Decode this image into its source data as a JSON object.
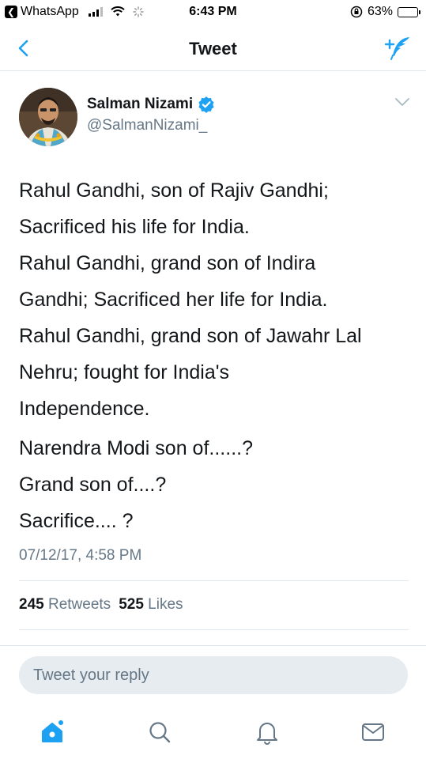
{
  "status_bar": {
    "back_app": "WhatsApp",
    "time": "6:43 PM",
    "battery": "63%",
    "battery_level": 0.63
  },
  "nav": {
    "title": "Tweet",
    "back_icon": "chevron-left-icon",
    "compose_icon": "compose-tweet-icon"
  },
  "tweet": {
    "author_name": "Salman Nizami",
    "author_handle": "@SalmanNizami_",
    "lines": [
      "Rahul Gandhi, son of Rajiv Gandhi;",
      "Sacrificed his life for India.",
      "Rahul Gandhi, grand son of Indira",
      "Gandhi; Sacrificed her life for India.",
      "Rahul Gandhi, grand son of Jawahr Lal",
      "Nehru; fought for India's",
      "Independence."
    ],
    "questions": [
      "Narendra Modi son of......?",
      "Grand son of....?",
      "Sacrifice.... ?"
    ],
    "timestamp": "07/12/17, 4:58 PM",
    "retweets_count": "245",
    "retweets_label": "Retweets",
    "likes_count": "525",
    "likes_label": "Likes"
  },
  "reply": {
    "placeholder": "Tweet your reply"
  },
  "tabs": [
    "home-icon",
    "search-icon",
    "notifications-icon",
    "messages-icon"
  ],
  "colors": {
    "accent": "#1da1f2",
    "text": "#14171a",
    "muted": "#657786",
    "divider": "#e1e8ed"
  }
}
